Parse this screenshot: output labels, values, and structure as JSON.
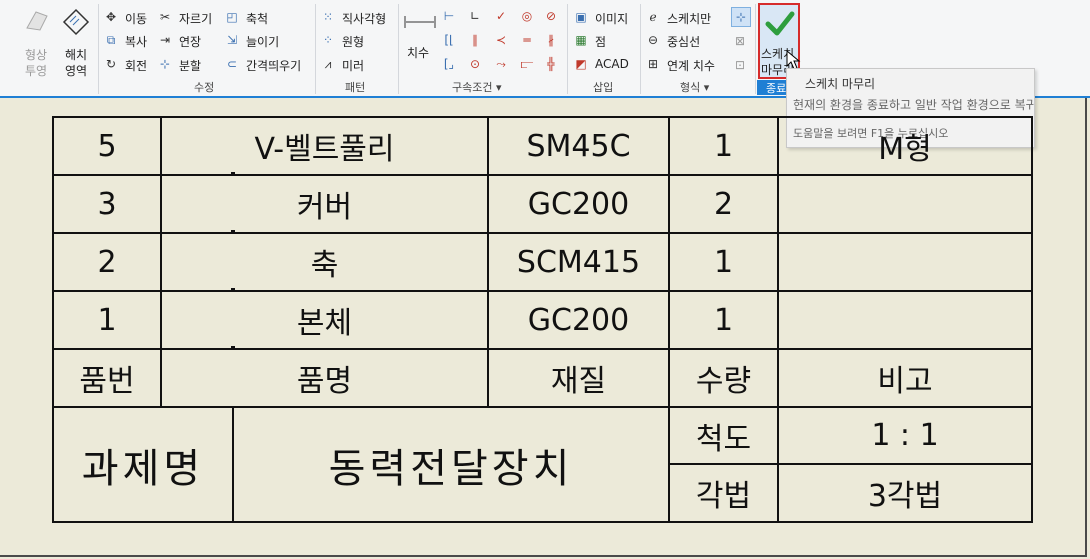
{
  "ribbon": {
    "geometry": {
      "shape_top": "형상",
      "shape_bottom": "투영",
      "hatch_top": "해치",
      "hatch_bottom": "영역"
    },
    "modify": {
      "move": "이동",
      "copy": "복사",
      "rotate": "회전",
      "trim": "자르기",
      "extend": "연장",
      "split": "분할",
      "scale": "축척",
      "stretch": "늘이기",
      "offset": "간격띄우기",
      "group_label": "수정"
    },
    "pattern": {
      "rect": "직사각형",
      "circular": "원형",
      "mirror": "미러",
      "group_label": "패턴"
    },
    "constraint": {
      "dimension": "치수",
      "group_label": "구속조건 ▾"
    },
    "insert": {
      "image": "이미지",
      "point": "점",
      "acad": "ACAD",
      "group_label": "삽입"
    },
    "format": {
      "sketch_only": "스케치만",
      "centerline": "중심선",
      "assoc_dim": "연계 치수",
      "group_label": "형식 ▾"
    },
    "exit": {
      "finish_top": "스케치",
      "finish_bottom": "마무리",
      "group_label": "종료"
    }
  },
  "tooltip": {
    "title": "스케치 마무리",
    "description": "현재의 환경을 종료하고 일반 작업 환경으로 복귀합니다",
    "help": "도움말을 보려면 F1을 누르십시오"
  },
  "drawing": {
    "parts": [
      {
        "no": "5",
        "name": "V-벨트풀리",
        "material": "SM45C",
        "qty": "1",
        "note": "M형"
      },
      {
        "no": "3",
        "name": "커버",
        "material": "GC200",
        "qty": "2",
        "note": ""
      },
      {
        "no": "2",
        "name": "축",
        "material": "SCM415",
        "qty": "1",
        "note": ""
      },
      {
        "no": "1",
        "name": "본체",
        "material": "GC200",
        "qty": "1",
        "note": ""
      }
    ],
    "header": {
      "no": "품번",
      "name": "품명",
      "material": "재질",
      "qty": "수량",
      "note": "비고"
    },
    "title_block": {
      "project_label": "과제명",
      "project_name": "동력전달장치",
      "scale_label": "척도",
      "scale_value": "1 : 1",
      "method_label": "각법",
      "method_value": "3각법"
    }
  },
  "colors": {
    "accent": "#1f7fd4",
    "highlight_border": "#d62b2b",
    "check": "#2e9e3e",
    "background": "#ecead9"
  }
}
